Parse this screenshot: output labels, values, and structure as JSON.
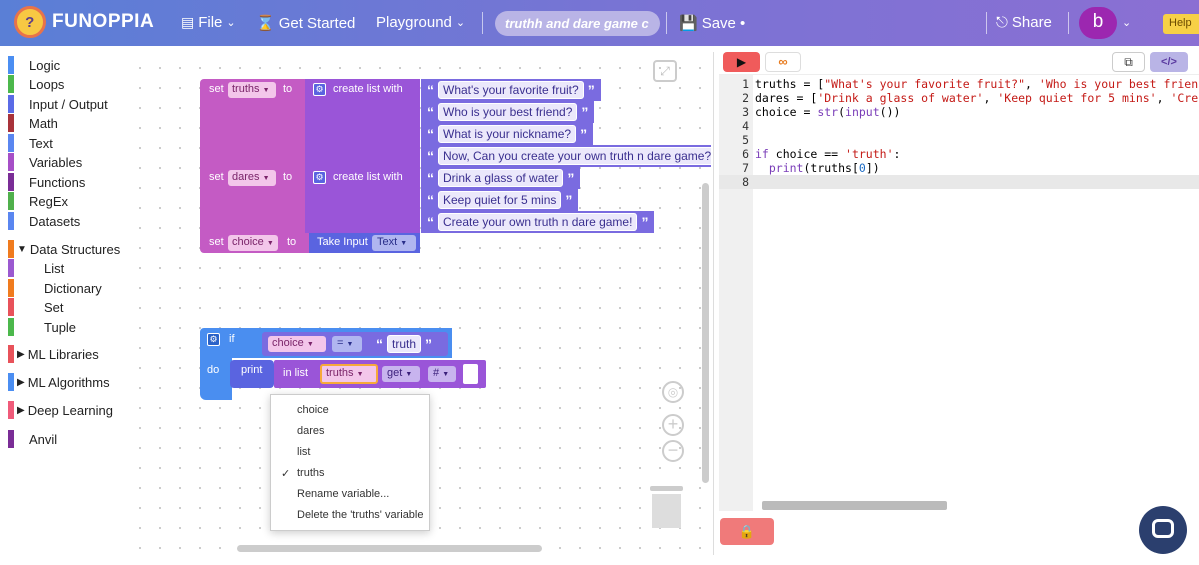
{
  "header": {
    "logo": "FUNOPPIA",
    "file": "File",
    "get_started": "Get Started",
    "playground": "Playground",
    "project_name": "truthh and dare game c",
    "save": "Save •",
    "share": "Share",
    "avatar": "b",
    "help": "Help"
  },
  "sidebar": {
    "items": [
      {
        "label": "Logic",
        "color": "#4b8ef2"
      },
      {
        "label": "Loops",
        "color": "#4cb84c"
      },
      {
        "label": "Input / Output",
        "color": "#5a6be6"
      },
      {
        "label": "Math",
        "color": "#a8323a"
      },
      {
        "label": "Text",
        "color": "#5a86f0"
      },
      {
        "label": "Variables",
        "color": "#a64fc7"
      },
      {
        "label": "Functions",
        "color": "#7a2d96"
      },
      {
        "label": "RegEx",
        "color": "#50b04c"
      },
      {
        "label": "Datasets",
        "color": "#5a86f0"
      },
      {
        "label": "Data Structures",
        "color": "#f07b1e"
      },
      {
        "label": "List",
        "color": "#9b59d0"
      },
      {
        "label": "Dictionary",
        "color": "#f07b1e"
      },
      {
        "label": "Set",
        "color": "#e8525a"
      },
      {
        "label": "Tuple",
        "color": "#4cb84c"
      },
      {
        "label": "ML Libraries",
        "color": "#e8525a"
      },
      {
        "label": "ML Algorithms",
        "color": "#4b8ef2"
      },
      {
        "label": "Deep Learning",
        "color": "#f05b7a"
      },
      {
        "label": "Anvil",
        "color": "#7a2d96"
      }
    ]
  },
  "blocks": {
    "set": "set",
    "to": "to",
    "create_list_with": "create list with",
    "var_truths": "truths",
    "var_dares": "dares",
    "var_choice": "choice",
    "truths": [
      "What's your favorite fruit?",
      "Who is your best friend?",
      "What is your nickname?",
      "Now, Can you create your own truth n dare game?"
    ],
    "dares": [
      "Drink a glass of water",
      "Keep quiet for 5 mins",
      "Create your own truth n dare game!"
    ],
    "take_input": "Take Input",
    "input_type": "Text",
    "if": "if",
    "do": "do",
    "eq": "=",
    "truth_str": "truth",
    "print": "print",
    "in_list": "in list",
    "get": "get",
    "hash": "#"
  },
  "var_menu": {
    "items": [
      "choice",
      "dares",
      "list",
      "truths",
      "Rename variable...",
      "Delete the 'truths' variable"
    ],
    "checked": "truths"
  },
  "editor": {
    "lines": [
      {
        "n": "1",
        "text": "truths = [\"What's your favorite fruit?\", 'Who is your best frien"
      },
      {
        "n": "2",
        "text": "dares = ['Drink a glass of water', 'Keep quiet for 5 mins', 'Cre"
      },
      {
        "n": "3",
        "text": "choice = str(input())"
      },
      {
        "n": "4",
        "text": ""
      },
      {
        "n": "5",
        "text": ""
      },
      {
        "n": "6",
        "text": "if choice == 'truth':"
      },
      {
        "n": "7",
        "text": "  print(truths[0])"
      },
      {
        "n": "8",
        "text": ""
      }
    ]
  }
}
